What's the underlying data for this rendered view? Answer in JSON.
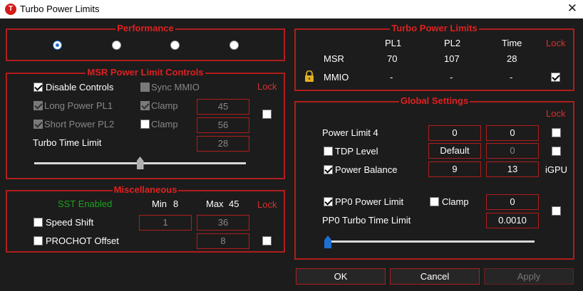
{
  "window": {
    "app_icon": "T",
    "title": "Turbo Power Limits",
    "close_glyph": "✕"
  },
  "performance": {
    "title": "Performance",
    "options": [
      {
        "selected": true
      },
      {
        "selected": false
      },
      {
        "selected": false
      },
      {
        "selected": false
      }
    ]
  },
  "msr": {
    "title": "MSR Power Limit Controls",
    "disable_controls": {
      "label": "Disable Controls",
      "checked": true
    },
    "sync_mmio": {
      "label": "Sync MMIO",
      "checked": false
    },
    "lock": {
      "label": "Lock",
      "checked": false
    },
    "long_power": {
      "label": "Long Power PL1",
      "checked": true,
      "clamp_label": "Clamp",
      "clamp_checked": true,
      "value": "45"
    },
    "short_power": {
      "label": "Short Power PL2",
      "checked": true,
      "clamp_label": "Clamp",
      "clamp_checked": false,
      "value": "56"
    },
    "turbo_time": {
      "label": "Turbo Time Limit",
      "value": "28",
      "slider_fraction": 0.5
    }
  },
  "misc": {
    "title": "Miscellaneous",
    "sst_status": "SST Enabled",
    "min_label": "Min",
    "min_value": "8",
    "max_label": "Max",
    "max_value": "45",
    "lock_label": "Lock",
    "speed_shift": {
      "label": "Speed Shift",
      "checked": false,
      "min": "1",
      "max": "36"
    },
    "prochot": {
      "label": "PROCHOT Offset",
      "checked": false,
      "value": "8"
    },
    "lock_checked": false
  },
  "turbo": {
    "title": "Turbo Power Limits",
    "headers": [
      "PL1",
      "PL2",
      "Time",
      "Lock"
    ],
    "msr_row": {
      "label": "MSR",
      "pl1": "70",
      "pl2": "107",
      "time": "28"
    },
    "mmio_row": {
      "label": "MMIO",
      "pl1": "-",
      "pl2": "-",
      "time": "-",
      "lock_checked": true
    }
  },
  "global": {
    "title": "Global Settings",
    "lock_label": "Lock",
    "power_limit_4": {
      "label": "Power Limit 4",
      "value1": "0",
      "value2": "0",
      "checked": false
    },
    "tdp_level": {
      "label": "TDP Level",
      "checked": false,
      "value1": "Default",
      "value2": "0",
      "lock_checked": false
    },
    "power_balance": {
      "label": "Power Balance",
      "checked": true,
      "value1": "9",
      "value2": "13",
      "suffix": "iGPU"
    },
    "pp0": {
      "label": "PP0 Power Limit",
      "checked": true,
      "clamp_label": "Clamp",
      "clamp_checked": false,
      "value": "0",
      "lock_checked": false
    },
    "pp0_turbo": {
      "label": "PP0 Turbo Time Limit",
      "value": "0.0010",
      "slider_fraction": 0.0
    }
  },
  "buttons": {
    "ok": "OK",
    "cancel": "Cancel",
    "apply": "Apply"
  }
}
